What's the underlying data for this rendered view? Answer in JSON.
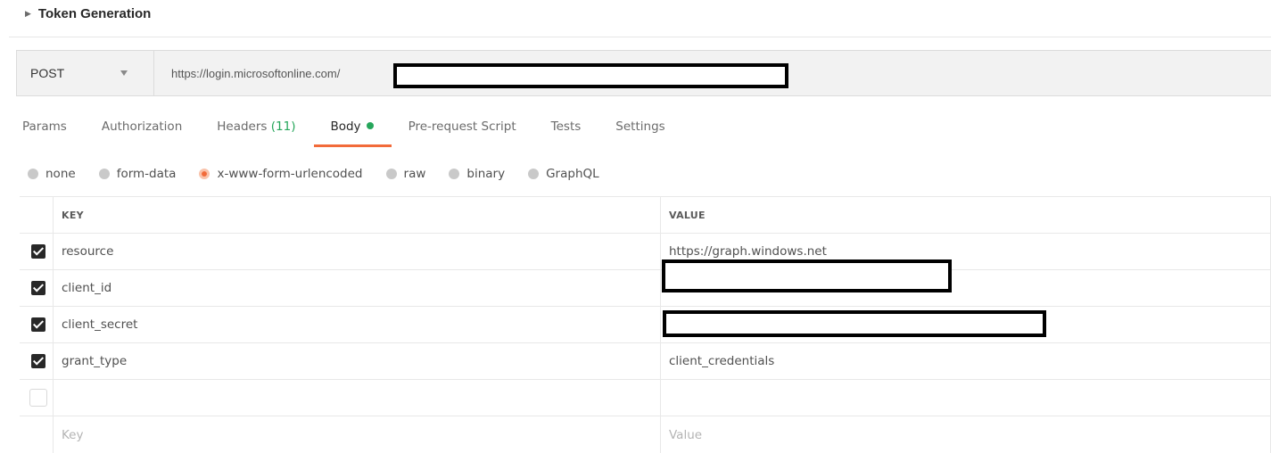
{
  "section": {
    "caret_icon": "triangle-right-icon",
    "title": "Token Generation"
  },
  "request": {
    "method": "POST",
    "url": "https://login.microsoftonline.com/"
  },
  "tabs": [
    {
      "label": "Params"
    },
    {
      "label": "Authorization"
    },
    {
      "label": "Headers",
      "count": "(11)"
    },
    {
      "label": "Body",
      "active": true,
      "indicator": "green-dot"
    },
    {
      "label": "Pre-request Script"
    },
    {
      "label": "Tests"
    },
    {
      "label": "Settings"
    }
  ],
  "body_types": [
    {
      "label": "none",
      "selected": false
    },
    {
      "label": "form-data",
      "selected": false
    },
    {
      "label": "x-www-form-urlencoded",
      "selected": true
    },
    {
      "label": "raw",
      "selected": false
    },
    {
      "label": "binary",
      "selected": false
    },
    {
      "label": "GraphQL",
      "selected": false
    }
  ],
  "table": {
    "headers": {
      "key": "KEY",
      "value": "VALUE"
    },
    "rows": [
      {
        "checked": true,
        "key": "resource",
        "value": "https://graph.windows.net"
      },
      {
        "checked": true,
        "key": "client_id",
        "value": ""
      },
      {
        "checked": true,
        "key": "client_secret",
        "value": ""
      },
      {
        "checked": true,
        "key": "grant_type",
        "value": "client_credentials"
      },
      {
        "checked": false,
        "key": "",
        "value": ""
      }
    ],
    "placeholders": {
      "key": "Key",
      "value": "Value"
    }
  },
  "colors": {
    "accent_orange": "#f26b3a",
    "green": "#26a65b",
    "checkbox_dark": "#282828"
  }
}
